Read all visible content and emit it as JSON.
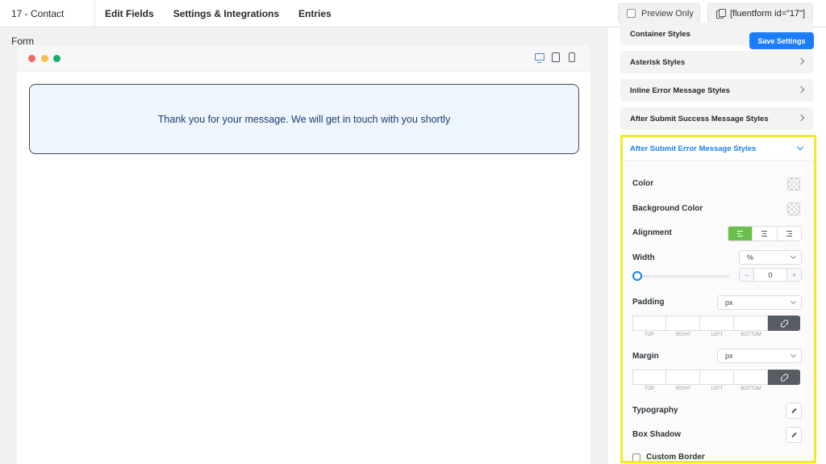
{
  "topbar": {
    "form_title": "17 - Contact Form",
    "nav": [
      "Edit Fields",
      "Settings & Integrations",
      "Entries"
    ],
    "preview_label": "Preview Only",
    "shortcode": "[fluentform id=\"17\"]"
  },
  "preview": {
    "message": "Thank you for your message. We will get in touch with you shortly"
  },
  "panel": {
    "save_label": "Save Settings",
    "sections": [
      "Container Styles",
      "Asterisk Styles",
      "Inline Error Message Styles",
      "After Submit Success Message Styles"
    ],
    "open_section": "After Submit Error Message Styles",
    "fields": {
      "color": "Color",
      "background_color": "Background Color",
      "alignment": "Alignment",
      "width": "Width",
      "width_unit": "%",
      "width_value": "0",
      "padding": "Padding",
      "padding_unit": "px",
      "margin": "Margin",
      "margin_unit": "px",
      "typography": "Typography",
      "box_shadow": "Box Shadow",
      "custom_border": "Custom Border"
    },
    "box_labels": [
      "TOP",
      "RIGHT",
      "LEFT",
      "BOTTOM"
    ],
    "stepper_minus": "−",
    "stepper_plus": "+"
  },
  "colors": {
    "accent": "#1a7efb",
    "highlight": "#f2ea2b",
    "alignment_active": "#6bc04b"
  }
}
